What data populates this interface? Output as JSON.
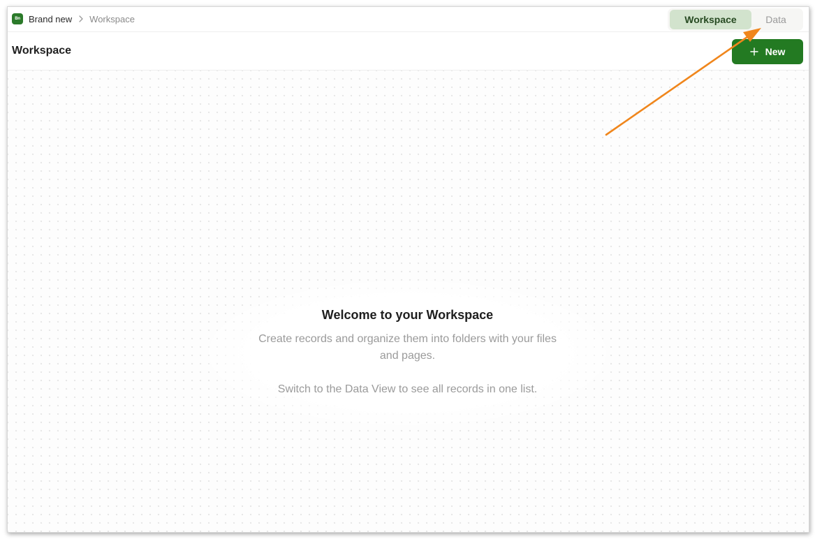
{
  "breadcrumb": {
    "logo_text": "Bn",
    "root": "Brand new",
    "current": "Workspace"
  },
  "view_toggle": {
    "workspace_label": "Workspace",
    "data_label": "Data",
    "selected": "Workspace"
  },
  "header": {
    "title": "Workspace",
    "new_button_label": "New"
  },
  "welcome": {
    "title": "Welcome to your Workspace",
    "line1": "Create records and organize them into folders with your files and pages.",
    "line2": "Switch to the Data View to see all records in one list."
  },
  "colors": {
    "brand_green": "#237a22",
    "toggle_selected_bg": "#d2e3cd",
    "annotation_orange": "#f0861c"
  },
  "icons": {
    "logo": "app-logo-icon",
    "separator": "chevron-right-icon",
    "new": "plus-icon"
  }
}
